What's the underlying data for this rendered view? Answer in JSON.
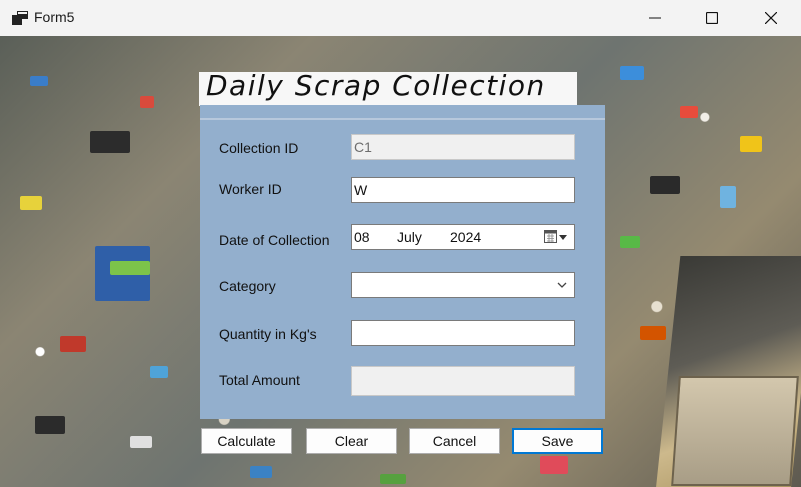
{
  "window": {
    "title": "Form5",
    "icon": "app-window-icon"
  },
  "heading": "Daily Scrap Collection",
  "form": {
    "collection_id": {
      "label": "Collection ID",
      "value": "C1"
    },
    "worker_id": {
      "label": "Worker ID",
      "value": "W"
    },
    "date_of_collection": {
      "label": "Date of Collection",
      "day": "08",
      "month": "July",
      "year": "2024"
    },
    "category": {
      "label": "Category",
      "value": ""
    },
    "quantity": {
      "label": "Quantity in Kg's",
      "value": ""
    },
    "total_amount": {
      "label": "Total Amount",
      "value": ""
    }
  },
  "buttons": {
    "calculate": "Calculate",
    "clear": "Clear",
    "cancel": "Cancel",
    "save": "Save"
  },
  "colors": {
    "panel": "#93afcd",
    "accent": "#0078d4"
  }
}
